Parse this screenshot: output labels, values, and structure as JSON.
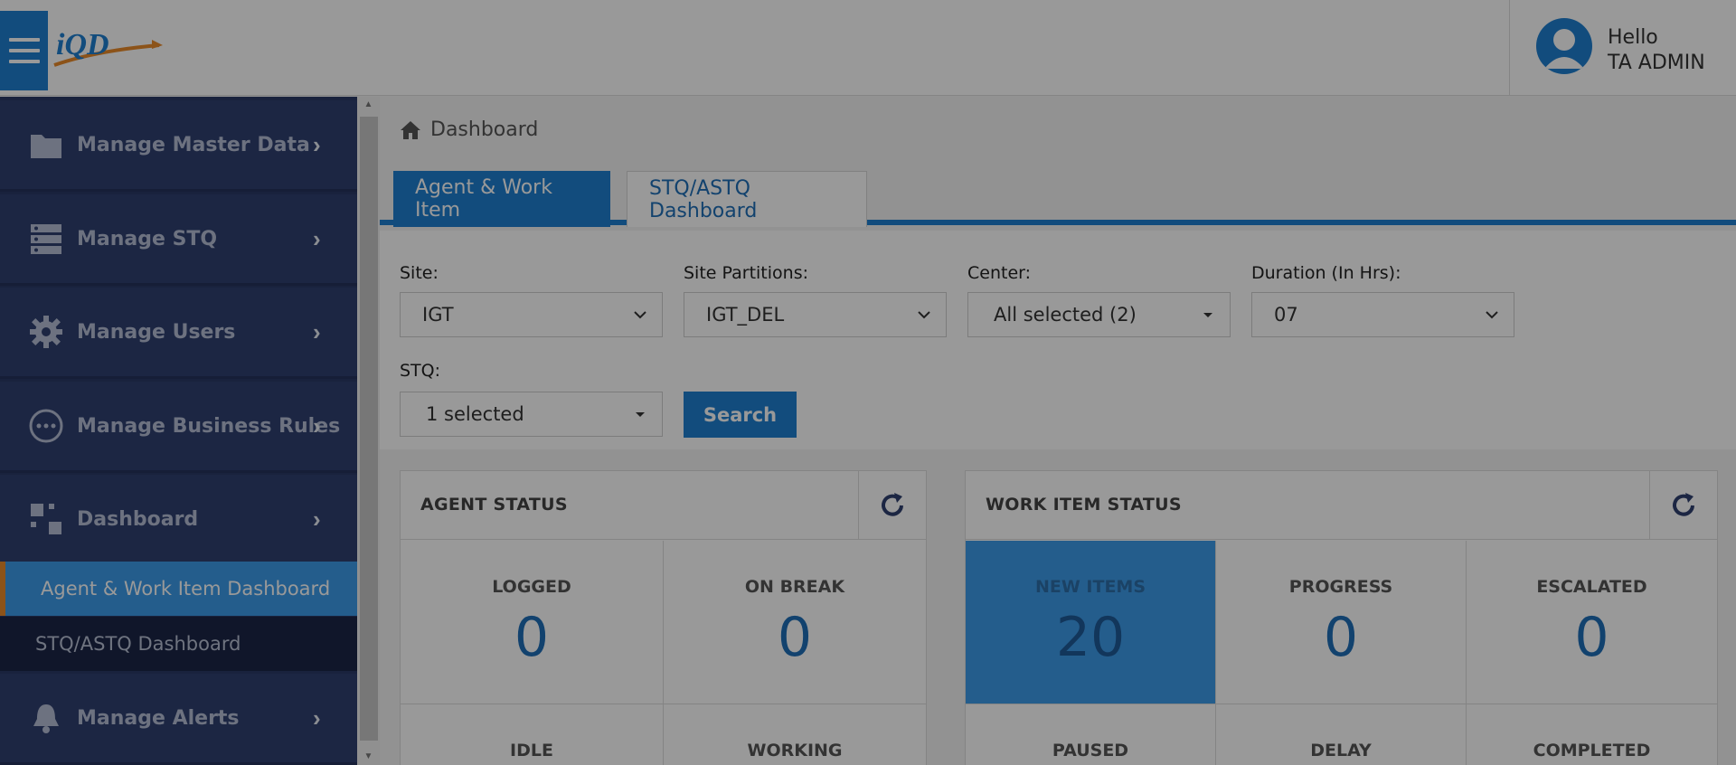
{
  "header": {
    "logo_text": "iQD",
    "greeting": "Hello",
    "username": "TA ADMIN"
  },
  "sidebar": {
    "items": [
      {
        "label": "Manage Master Data",
        "icon": "folder-icon"
      },
      {
        "label": "Manage STQ",
        "icon": "server-icon"
      },
      {
        "label": "Manage Users",
        "icon": "gear-icon"
      },
      {
        "label": "Manage Business Rules",
        "icon": "more-circle-icon"
      },
      {
        "label": "Dashboard",
        "icon": "grid-icon"
      },
      {
        "label": "Manage Alerts",
        "icon": "bell-icon"
      }
    ],
    "sub_items": [
      {
        "label": "Agent & Work Item Dashboard",
        "active": true
      },
      {
        "label": "STQ/ASTQ Dashboard",
        "active": false
      }
    ]
  },
  "breadcrumb": {
    "label": "Dashboard"
  },
  "tabs": [
    {
      "label": "Agent & Work Item",
      "active": true
    },
    {
      "label": "STQ/ASTQ Dashboard",
      "active": false
    }
  ],
  "filters": {
    "site": {
      "label": "Site:",
      "value": "IGT"
    },
    "partitions": {
      "label": "Site Partitions:",
      "value": "IGT_DEL"
    },
    "center": {
      "label": "Center:",
      "value": "All selected (2)"
    },
    "duration": {
      "label": "Duration (In Hrs):",
      "value": "07"
    },
    "stq": {
      "label": "STQ:",
      "value": "1 selected"
    },
    "search_label": "Search"
  },
  "agent_status": {
    "title": "AGENT STATUS",
    "cells": [
      {
        "label": "LOGGED",
        "value": "0"
      },
      {
        "label": "ON BREAK",
        "value": "0"
      },
      {
        "label": "IDLE"
      },
      {
        "label": "WORKING"
      }
    ]
  },
  "work_item_status": {
    "title": "WORK ITEM STATUS",
    "cells": [
      {
        "label": "NEW ITEMS",
        "value": "20"
      },
      {
        "label": "PROGRESS",
        "value": "0"
      },
      {
        "label": "ESCALATED",
        "value": "0"
      },
      {
        "label": "PAUSED"
      },
      {
        "label": "DELAY"
      },
      {
        "label": "COMPLETED"
      }
    ]
  },
  "colors": {
    "brand_blue": "#1f7fd0",
    "sidebar_bg": "#2f4070",
    "active_accent": "#e98a2b",
    "highlight_cell": "#3d9be9"
  }
}
